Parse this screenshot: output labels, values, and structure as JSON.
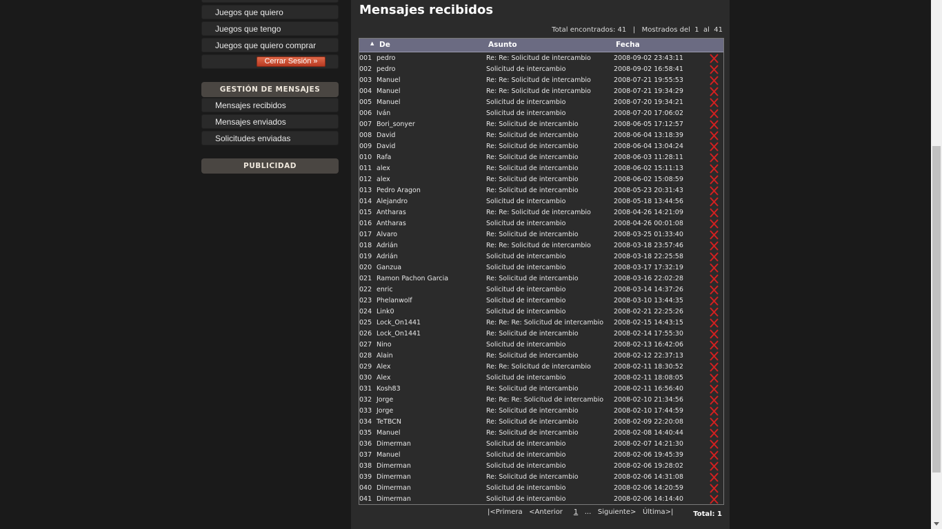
{
  "sidebar": {
    "items_top": [
      "Juegos que quiero",
      "Juegos que tengo",
      "Juegos que quiero comprar"
    ],
    "logout_label": "Cerrar Sesión »",
    "messages_header": "GESTIÓN DE MENSAJES",
    "messages_items": [
      "Mensajes recibidos",
      "Mensajes enviados",
      "Solicitudes enviadas"
    ],
    "ads_header": "PUBLICIDAD"
  },
  "main": {
    "title": "Mensajes recibidos",
    "summary": "Total encontrados: 41   |   Mostrados del  1  al  41",
    "columns": {
      "from": "De",
      "subject": "Asunto",
      "date": "Fecha"
    },
    "rows": [
      [
        "001",
        "pedro",
        "Re: Re: Solicitud de intercambio",
        "2008-09-02 23:43:11"
      ],
      [
        "002",
        "pedro",
        "Solicitud de intercambio",
        "2008-09-02 16:58:41"
      ],
      [
        "003",
        "Manuel",
        "Re: Re: Solicitud de intercambio",
        "2008-07-21 19:55:53"
      ],
      [
        "004",
        "Manuel",
        "Re: Re: Solicitud de intercambio",
        "2008-07-21 19:34:29"
      ],
      [
        "005",
        "Manuel",
        "Solicitud de intercambio",
        "2008-07-20 19:34:21"
      ],
      [
        "006",
        "Iván",
        "Solicitud de intercambio",
        "2008-07-20 17:06:02"
      ],
      [
        "007",
        "Bori_sonyer",
        "Re: Solicitud de intercambio",
        "2008-06-05 17:12:57"
      ],
      [
        "008",
        "David",
        "Re: Solicitud de intercambio",
        "2008-06-04 13:18:39"
      ],
      [
        "009",
        "David",
        "Re: Solicitud de intercambio",
        "2008-06-04 13:04:24"
      ],
      [
        "010",
        "Rafa",
        "Re: Solicitud de intercambio",
        "2008-06-03 11:28:11"
      ],
      [
        "011",
        "alex",
        "Re: Solicitud de intercambio",
        "2008-06-02 15:11:13"
      ],
      [
        "012",
        "alex",
        "Re: Solicitud de intercambio",
        "2008-06-02 15:08:59"
      ],
      [
        "013",
        "Pedro Aragon",
        "Re: Solicitud de intercambio",
        "2008-05-23 20:31:43"
      ],
      [
        "014",
        "Alejandro",
        "Solicitud de intercambio",
        "2008-05-18 13:44:56"
      ],
      [
        "015",
        "Antharas",
        "Re: Re: Solicitud de intercambio",
        "2008-04-26 14:21:09"
      ],
      [
        "016",
        "Antharas",
        "Solicitud de intercambio",
        "2008-04-26 00:01:08"
      ],
      [
        "017",
        "Alvaro",
        "Re: Solicitud de intercambio",
        "2008-03-25 01:33:40"
      ],
      [
        "018",
        "Adrián",
        "Re: Re: Solicitud de intercambio",
        "2008-03-18 23:57:46"
      ],
      [
        "019",
        "Adrián",
        "Solicitud de intercambio",
        "2008-03-18 22:25:58"
      ],
      [
        "020",
        "Ganzua",
        "Solicitud de intercambio",
        "2008-03-17 17:32:19"
      ],
      [
        "021",
        "Ramon Pachon Garcia",
        "Re: Solicitud de intercambio",
        "2008-03-16 22:02:28"
      ],
      [
        "022",
        "enric",
        "Solicitud de intercambio",
        "2008-03-14 14:37:26"
      ],
      [
        "023",
        "Phelanwolf",
        "Solicitud de intercambio",
        "2008-03-10 13:44:35"
      ],
      [
        "024",
        "Link0",
        "Solicitud de intercambio",
        "2008-02-21 22:25:26"
      ],
      [
        "025",
        "Lock_On1441",
        "Re: Re: Re: Solicitud de intercambio",
        "2008-02-15 14:43:15"
      ],
      [
        "026",
        "Lock_On1441",
        "Re: Solicitud de intercambio",
        "2008-02-14 17:55:30"
      ],
      [
        "027",
        "Nino",
        "Solicitud de intercambio",
        "2008-02-13 16:42:06"
      ],
      [
        "028",
        "Alain",
        "Re: Solicitud de intercambio",
        "2008-02-12 22:37:13"
      ],
      [
        "029",
        "Alex",
        "Re: Re: Solicitud de intercambio",
        "2008-02-11 18:30:52"
      ],
      [
        "030",
        "Alex",
        "Solicitud de intercambio",
        "2008-02-11 18:08:05"
      ],
      [
        "031",
        "Kosh83",
        "Re: Solicitud de intercambio",
        "2008-02-11 16:56:40"
      ],
      [
        "032",
        "Jorge",
        "Re: Re: Re: Solicitud de intercambio",
        "2008-02-10 21:34:56"
      ],
      [
        "033",
        "Jorge",
        "Re: Solicitud de intercambio",
        "2008-02-10 17:44:59"
      ],
      [
        "034",
        "TeTBCN",
        "Re: Solicitud de intercambio",
        "2008-02-09 22:20:08"
      ],
      [
        "035",
        "Manuel",
        "Re: Solicitud de intercambio",
        "2008-02-08 14:40:44"
      ],
      [
        "036",
        "Dimerman",
        "Solicitud de intercambio",
        "2008-02-07 14:21:30"
      ],
      [
        "037",
        "Manuel",
        "Solicitud de intercambio",
        "2008-02-06 19:45:39"
      ],
      [
        "038",
        "Dimerman",
        "Solicitud de intercambio",
        "2008-02-06 19:28:02"
      ],
      [
        "039",
        "Dimerman",
        "Re: Solicitud de intercambio",
        "2008-02-06 14:31:08"
      ],
      [
        "040",
        "Dimerman",
        "Solicitud de intercambio",
        "2008-02-06 14:20:59"
      ],
      [
        "041",
        "Dimerman",
        "Solicitud de intercambio",
        "2008-02-06 14:14:40"
      ]
    ],
    "pager": {
      "first": "|<Primera",
      "prev": "<Anterior",
      "current": "1",
      "ellipsis": "...",
      "next": "Siguiente>",
      "last": "Última>|"
    },
    "total": "Total:  1"
  },
  "colors": {
    "header_bg": "#6b6b82",
    "delete_red": "#d42020",
    "logout_btn": "#c84a2e"
  }
}
